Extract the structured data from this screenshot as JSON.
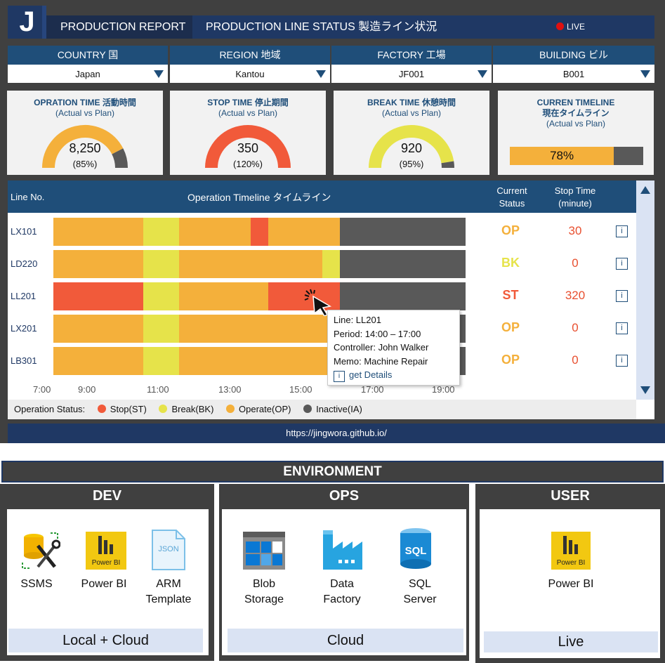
{
  "header": {
    "logo": "J",
    "report_title": "PRODUCTION REPORT",
    "line_status": "PRODUCTION LINE STATUS 製造ライン状況",
    "live_label": "LIVE"
  },
  "filters": [
    {
      "label": "COUNTRY 国",
      "value": "Japan"
    },
    {
      "label": "REGION 地域",
      "value": "Kantou"
    },
    {
      "label": "FACTORY 工場",
      "value": "JF001"
    },
    {
      "label": "BUILDING ビル",
      "value": "B001"
    }
  ],
  "kpis": [
    {
      "title": "OPRATION TIME 活動時間",
      "subtitle": "(Actual vs Plan)",
      "value": "8,250",
      "percent": "(85%)",
      "fraction": 0.85,
      "color": "#f4b03b"
    },
    {
      "title": "STOP TIME 停止期間",
      "subtitle": "(Actual vs Plan)",
      "value": "350",
      "percent": "(120%)",
      "fraction": 1.0,
      "color": "#f15a3a"
    },
    {
      "title": "BREAK TIME 休憩時間",
      "subtitle": "(Actual vs Plan)",
      "value": "920",
      "percent": "(95%)",
      "fraction": 0.95,
      "color": "#e6e34a"
    }
  ],
  "timeline_kpi": {
    "title_line1": "CURREN TIMELINE",
    "title_line2": "現在タイムライン",
    "subtitle": "(Actual vs Plan)",
    "value": "78%",
    "fraction": 0.78
  },
  "timeline": {
    "col_line": "Line No.",
    "col_timeline": "Operation Timeline タイムライン",
    "col_status_1": "Current",
    "col_status_2": "Status",
    "col_stop_1": "Stop Time",
    "col_stop_2": "(minute)",
    "info_icon": "i",
    "ticks": [
      "7:00",
      "9:00",
      "11:00",
      "13:00",
      "15:00",
      "17:00",
      "19:00"
    ],
    "rows": [
      {
        "line": "LX101",
        "status": "OP",
        "stop": "30"
      },
      {
        "line": "LD220",
        "status": "BK",
        "stop": "0"
      },
      {
        "line": "LL201",
        "status": "ST",
        "stop": "320"
      },
      {
        "line": "LX201",
        "status": "OP",
        "stop": "0"
      },
      {
        "line": "LB301",
        "status": "OP",
        "stop": "0"
      }
    ],
    "colors": {
      "ST": "#f15a3a",
      "BK": "#e6e34a",
      "OP": "#f4b03b",
      "IA": "#595959"
    },
    "legend_title": "Operation Status:",
    "legend": [
      {
        "label": "Stop(ST)",
        "color": "#f15a3a"
      },
      {
        "label": "Break(BK)",
        "color": "#e6e34a"
      },
      {
        "label": "Operate(OP)",
        "color": "#f4b03b"
      },
      {
        "label": "Inactive(IA)",
        "color": "#595959"
      }
    ]
  },
  "tooltip": {
    "line": "Line: LL201",
    "period": "Period: 14:00 – 17:00",
    "controller": "Controller: John Walker",
    "memo": "Memo:  Machine Repair",
    "details": "get Details"
  },
  "url": "https://jingwora.github.io/",
  "environment": {
    "title": "ENVIRONMENT",
    "dev": {
      "title": "DEV",
      "items": [
        "SSMS",
        "Power BI",
        "ARM\nTemplate"
      ],
      "footer": "Local + Cloud"
    },
    "ops": {
      "title": "OPS",
      "items": [
        "Blob\nStorage",
        "Data\nFactory",
        "SQL\nServer"
      ],
      "footer": "Cloud"
    },
    "user": {
      "title": "USER",
      "items": [
        "Power BI"
      ],
      "footer": "Live"
    },
    "icon_labels": {
      "powerbi": "Power BI",
      "json": "JSON",
      "sql": "SQL"
    }
  }
}
